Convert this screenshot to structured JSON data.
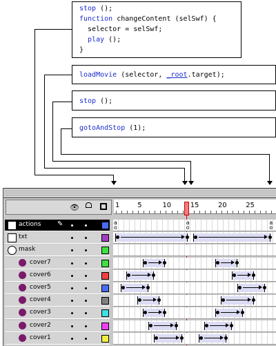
{
  "code_blocks": [
    {
      "lines": [
        [
          {
            "t": "stop",
            "k": "kw"
          },
          {
            "t": " ();",
            "k": ""
          }
        ],
        [
          {
            "t": "function",
            "k": "kw"
          },
          {
            "t": " changeContent (selSwf) {",
            "k": ""
          }
        ],
        [
          {
            "t": "  selector = selSwf;",
            "k": ""
          }
        ],
        [
          {
            "t": "  ",
            "k": ""
          },
          {
            "t": "play",
            "k": "kw"
          },
          {
            "t": " ();",
            "k": ""
          }
        ],
        [
          {
            "t": "}",
            "k": ""
          }
        ]
      ]
    },
    {
      "lines": [
        [
          {
            "t": "loadMovie",
            "k": "kw"
          },
          {
            "t": " (selector, ",
            "k": ""
          },
          {
            "t": "_root",
            "k": "kw2"
          },
          {
            "t": ".target);",
            "k": ""
          }
        ]
      ]
    },
    {
      "lines": [
        [
          {
            "t": "stop",
            "k": "kw"
          },
          {
            "t": " ();",
            "k": ""
          }
        ]
      ]
    },
    {
      "lines": [
        [
          {
            "t": "gotoAndStop",
            "k": "kw"
          },
          {
            "t": " (1);",
            "k": ""
          }
        ]
      ]
    }
  ],
  "ruler": {
    "labels": [
      "1",
      "5",
      "10",
      "15",
      "20",
      "25"
    ]
  },
  "layers": [
    {
      "name": "actions",
      "color": "#4a6cf0",
      "selected": true,
      "icon": "actions-layer-icon"
    },
    {
      "name": "txt",
      "color": "#a040c0",
      "selected": false,
      "icon": "layer-icon"
    },
    {
      "name": "mask",
      "color": "#40e040",
      "selected": false,
      "icon": "mask-layer-icon"
    },
    {
      "name": "cover7",
      "color": "#40e040",
      "selected": false,
      "icon": "masked-layer-icon"
    },
    {
      "name": "cover6",
      "color": "#f04040",
      "selected": false,
      "icon": "masked-layer-icon"
    },
    {
      "name": "cover5",
      "color": "#4a6cf0",
      "selected": false,
      "icon": "masked-layer-icon"
    },
    {
      "name": "cover4",
      "color": "#808080",
      "selected": false,
      "icon": "masked-layer-icon"
    },
    {
      "name": "cover3",
      "color": "#40e0e0",
      "selected": false,
      "icon": "masked-layer-icon"
    },
    {
      "name": "cover2",
      "color": "#f040f0",
      "selected": false,
      "icon": "masked-layer-icon"
    },
    {
      "name": "cover1",
      "color": "#f0f040",
      "selected": false,
      "icon": "masked-layer-icon"
    }
  ],
  "header_icons": [
    "eye-icon",
    "lock-icon",
    "outline-icon"
  ],
  "current_frame": 14
}
